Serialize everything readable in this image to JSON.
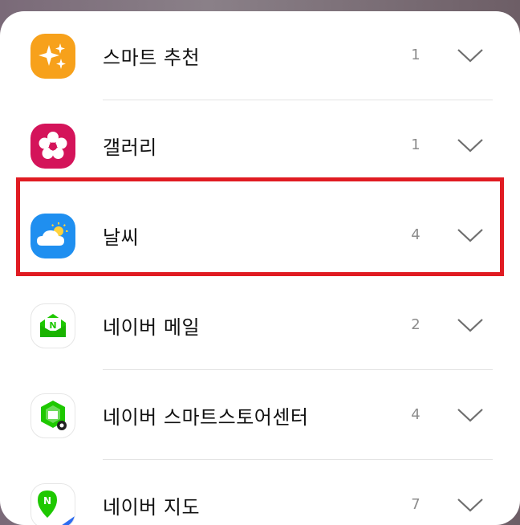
{
  "apps": [
    {
      "name": "스마트 추천",
      "count": "1",
      "icon": "sparkle-icon",
      "color": "#f7a11b"
    },
    {
      "name": "갤러리",
      "count": "1",
      "icon": "flower-icon",
      "color": "#d4145a"
    },
    {
      "name": "날씨",
      "count": "4",
      "icon": "weather-icon",
      "color": "#1f8ff0"
    },
    {
      "name": "네이버 메일",
      "count": "2",
      "icon": "naver-mail-icon",
      "color": "#1ec800"
    },
    {
      "name": "네이버 스마트스토어센터",
      "count": "4",
      "icon": "naver-store-icon",
      "color": "#1ec800"
    },
    {
      "name": "네이버 지도",
      "count": "7",
      "icon": "naver-map-icon",
      "color": "#1ec800"
    }
  ],
  "highlight_color": "#e01b22"
}
